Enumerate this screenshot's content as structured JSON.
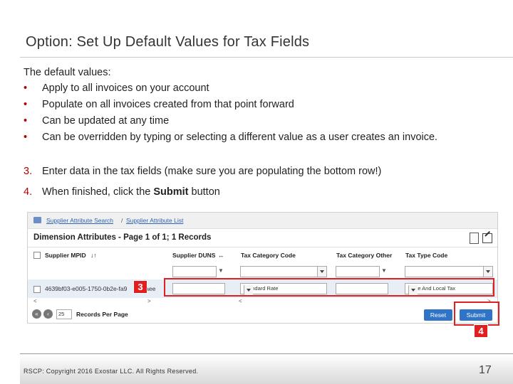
{
  "slide": {
    "title": "Option:  Set Up Default Values for Tax Fields",
    "intro": "The default values:",
    "bullet_char": "•",
    "bullets": [
      "Apply to all invoices on your account",
      "Populate on all invoices created from that point forward",
      "Can be updated at any time",
      "Can be overridden by typing or selecting a different value as a user creates an invoice."
    ],
    "step3_num": "3.",
    "step3_text": "Enter data in the tax fields (make sure you are populating the bottom row!)",
    "step4_num": "4.",
    "step4_text_pre": "When finished, click the ",
    "step4_text_bold": "Submit",
    "step4_text_post": " button",
    "footer_text": "RSCP:  Copyright 2016 Exostar LLC. All Rights Reserved.",
    "page_number": "17"
  },
  "screenshot": {
    "breadcrumb": {
      "link1": "Supplier Attribute Search",
      "separator": "/",
      "link2": "Supplier Attribute List"
    },
    "heading": "Dimension Attributes - Page 1 of 1; 1 Records",
    "columns": {
      "mpid": "Supplier MPID",
      "mpid_sort": "↓↑",
      "duns": "Supplier DUNS",
      "duns_sort": "↔",
      "tax_category_code": "Tax Category Code",
      "tax_category_other": "Tax Category Other",
      "tax_type_code": "Tax Type Code"
    },
    "row": {
      "id": "4639bf03-e005-1750-0b2e-fa9",
      "id_tail": "...aaee",
      "tax_category_code": "Standard Rate",
      "tax_type_code": "State And Local Tax"
    },
    "scroll_left": "<",
    "scroll_right": ">",
    "records_per_page_value": "25",
    "records_per_page_label": "Records Per Page",
    "reset_label": "Reset",
    "submit_label": "Submit",
    "callout3": "3",
    "callout4": "4",
    "accent_color": "#b30000",
    "callout_color": "#e02020",
    "button_color": "#2f74c6",
    "icons": [
      "home-icon",
      "excel-export-icon",
      "edit-icon",
      "filter-icon",
      "first-page-icon",
      "previous-page-icon"
    ]
  }
}
